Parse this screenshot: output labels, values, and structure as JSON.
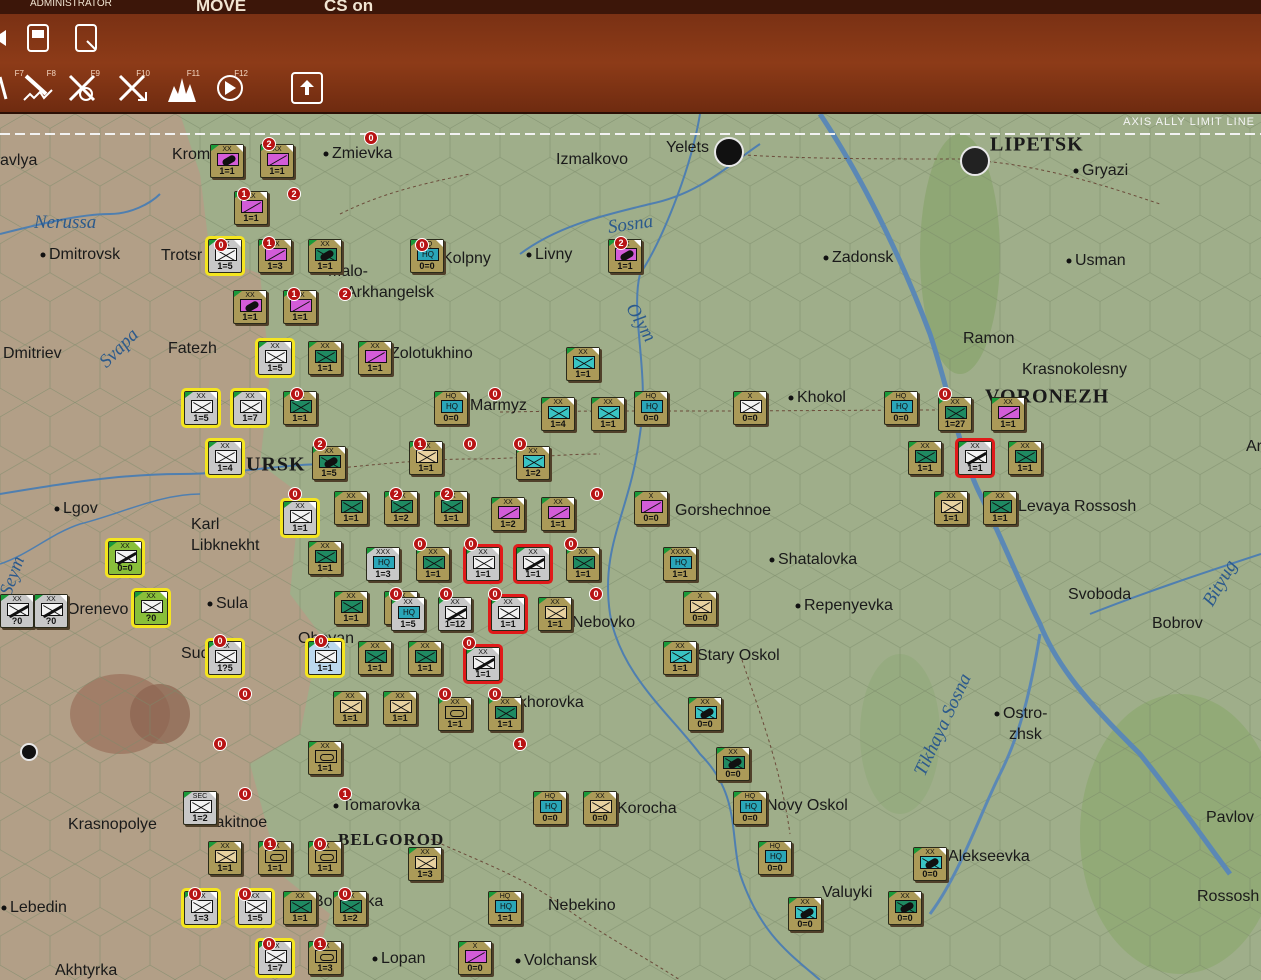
{
  "menu": {
    "items": [
      "ADMINISTRATOR",
      "MOVE",
      "CS on"
    ]
  },
  "toolbar": {
    "row1": [
      {
        "icon": "unit-button-icon"
      },
      {
        "icon": "unit-card-icon"
      }
    ],
    "row2": [
      {
        "key": "F7",
        "icon": "road-icon"
      },
      {
        "key": "F8",
        "icon": "bomber-icon"
      },
      {
        "key": "F9",
        "icon": "paratrooper-icon"
      },
      {
        "key": "F10",
        "icon": "air-strike-icon"
      },
      {
        "key": "F11",
        "icon": "explosion-icon"
      },
      {
        "key": "F12",
        "icon": "next-turn-icon"
      },
      {
        "key": "",
        "icon": "export-icon"
      }
    ]
  },
  "map": {
    "limit_line_label": "AXIS ALLY LIMIT LINE",
    "rivers": [
      {
        "name": "Nerussa"
      },
      {
        "name": "Sosna"
      },
      {
        "name": "Svapa"
      },
      {
        "name": "Olym"
      },
      {
        "name": "Seym"
      },
      {
        "name": "Bityug"
      },
      {
        "name": "Tikhaya Sosna"
      }
    ],
    "towns": [
      "avlya",
      "Krom",
      "Zmievka",
      "Izmalkovo",
      "Yelets",
      "LIPETSK",
      "Gryazi",
      "Dmitrovsk",
      "Trotsr",
      "Kolpny",
      "Livny",
      "Zadonsk",
      "Usman",
      "Malo-",
      "Arkhangelsk",
      "Dmitriev",
      "Fatezh",
      "Zolotukhino",
      "Ramon",
      "Krasnokolesny",
      "Marmyz",
      "Khokol",
      "VORONEZH",
      "URSK",
      "Lgov",
      "Karl",
      "Libknekht",
      "Gorshechnoe",
      "Levaya Rossosh",
      "Shatalovka",
      "Sula",
      "Orenevo",
      "Repenyevka",
      "Svoboda",
      "Bobrov",
      "Oboyan",
      "Sud",
      "Nebovko",
      "Stary Oskol",
      "Prokhorovka",
      "Ostro-",
      "zhsk",
      "Tomarovka",
      "Krasnopolye",
      "Rakitnoe",
      "BELGOROD",
      "Korocha",
      "Novy Oskol",
      "Pavlov",
      "Alekseevka",
      "Lebedin",
      "Nebekino",
      "Volchansk",
      "Lopan",
      "Borisovka",
      "Akhtyrka",
      "Rossosh",
      "Valuyki",
      "Ar"
    ]
  },
  "units": [
    {
      "value": "1=1",
      "size": "XX"
    },
    {
      "value": "1=1",
      "size": "XX"
    },
    {
      "value": "1=1",
      "size": "XX"
    },
    {
      "value": "1=5",
      "size": "XX"
    },
    {
      "value": "1=3",
      "size": "XX"
    },
    {
      "value": "1=1",
      "size": "XX"
    },
    {
      "value": "0=0",
      "size": "HQ"
    },
    {
      "value": "1=1",
      "size": "XX"
    },
    {
      "value": "1=1",
      "size": "XX"
    },
    {
      "value": "1=1",
      "size": "XX"
    },
    {
      "value": "1=5",
      "size": "XX"
    },
    {
      "value": "1=1",
      "size": "XX"
    },
    {
      "value": "1=1",
      "size": "XX"
    },
    {
      "value": "1=1",
      "size": "XX"
    },
    {
      "value": "0=0",
      "size": "HQ"
    },
    {
      "value": "1=4",
      "size": "XX"
    },
    {
      "value": "1=1",
      "size": "XX"
    },
    {
      "value": "0=0",
      "size": "HQ"
    },
    {
      "value": "0=0",
      "size": "X"
    },
    {
      "value": "0=0",
      "size": "HQ"
    },
    {
      "value": "1=27",
      "size": "XX"
    },
    {
      "value": "1=1",
      "size": "XX"
    },
    {
      "value": "1=5",
      "size": "XX"
    },
    {
      "value": "1=7",
      "size": "XX"
    },
    {
      "value": "1=1",
      "size": "XX"
    },
    {
      "value": "1=4",
      "size": "XX"
    },
    {
      "value": "1=5",
      "size": "XX"
    },
    {
      "value": "1=1",
      "size": "XX"
    },
    {
      "value": "1=2",
      "size": "XX"
    },
    {
      "value": "1=1",
      "size": "XX"
    },
    {
      "value": "1=1",
      "size": "XX"
    },
    {
      "value": "1=1",
      "size": "XX"
    },
    {
      "value": "1=1",
      "size": "XX"
    },
    {
      "value": "1=1",
      "size": "XX"
    },
    {
      "value": "1=2",
      "size": "XX"
    },
    {
      "value": "1=1",
      "size": "XX"
    },
    {
      "value": "1=2",
      "size": "XX"
    },
    {
      "value": "1=1",
      "size": "XX"
    },
    {
      "value": "1=1",
      "size": "XX"
    },
    {
      "value": "0=0",
      "size": "X"
    },
    {
      "value": "1=1",
      "size": "XX"
    },
    {
      "value": "1=1",
      "size": "XX"
    },
    {
      "value": "0=0",
      "size": "XX"
    },
    {
      "value": "1=3",
      "size": "XXX"
    },
    {
      "value": "1=1",
      "size": "XX"
    },
    {
      "value": "1=1",
      "size": "XX"
    },
    {
      "value": "1=1",
      "size": "XX"
    },
    {
      "value": "1=1",
      "size": "XX"
    },
    {
      "value": "1=1",
      "size": "XX"
    },
    {
      "value": "1=1",
      "size": "XXXX"
    },
    {
      "value": "1=1",
      "size": "XX"
    },
    {
      "value": "?0",
      "size": "XX"
    },
    {
      "value": "?0",
      "size": "XX"
    },
    {
      "value": "?0",
      "size": "XX"
    },
    {
      "value": "1=1",
      "size": "XX"
    },
    {
      "value": "1=5",
      "size": "XX"
    },
    {
      "value": "1=12",
      "size": "XX"
    },
    {
      "value": "1=1",
      "size": "XX"
    },
    {
      "value": "1=1",
      "size": "XX"
    },
    {
      "value": "0=0",
      "size": "X"
    },
    {
      "value": "1?5",
      "size": "XX"
    },
    {
      "value": "1=1",
      "size": "XX"
    },
    {
      "value": "1=1",
      "size": "XX"
    },
    {
      "value": "1=1",
      "size": "XX"
    },
    {
      "value": "1=1",
      "size": "XX"
    },
    {
      "value": "1=1",
      "size": "XX"
    },
    {
      "value": "1=1",
      "size": "XX"
    },
    {
      "value": "1=1",
      "size": "XX"
    },
    {
      "value": "1=1",
      "size": "XX"
    },
    {
      "value": "1=1",
      "size": "XX"
    },
    {
      "value": "0=0",
      "size": "XX"
    },
    {
      "value": "0=0",
      "size": "XX"
    },
    {
      "value": "1=1",
      "size": "XX"
    },
    {
      "value": "1=2",
      "size": "SEC"
    },
    {
      "value": "0=0",
      "size": "HQ"
    },
    {
      "value": "0=0",
      "size": "XX"
    },
    {
      "value": "0=0",
      "size": "HQ"
    },
    {
      "value": "1=1",
      "size": "XX"
    },
    {
      "value": "1=1",
      "size": "XX"
    },
    {
      "value": "1=1",
      "size": "XX"
    },
    {
      "value": "1=3",
      "size": "XX"
    },
    {
      "value": "0=0",
      "size": "HQ"
    },
    {
      "value": "0=0",
      "size": "XX"
    },
    {
      "value": "1=3",
      "size": "XX"
    },
    {
      "value": "1=5",
      "size": "XX"
    },
    {
      "value": "1=1",
      "size": "XX"
    },
    {
      "value": "1=2",
      "size": "XX"
    },
    {
      "value": "1=1",
      "size": "HQ"
    },
    {
      "value": "0=0",
      "size": "XX"
    },
    {
      "value": "0=0",
      "size": "XX"
    },
    {
      "value": "1=7",
      "size": "XX"
    },
    {
      "value": "1=3",
      "size": "XX"
    },
    {
      "value": "0=0",
      "size": "X"
    }
  ]
}
